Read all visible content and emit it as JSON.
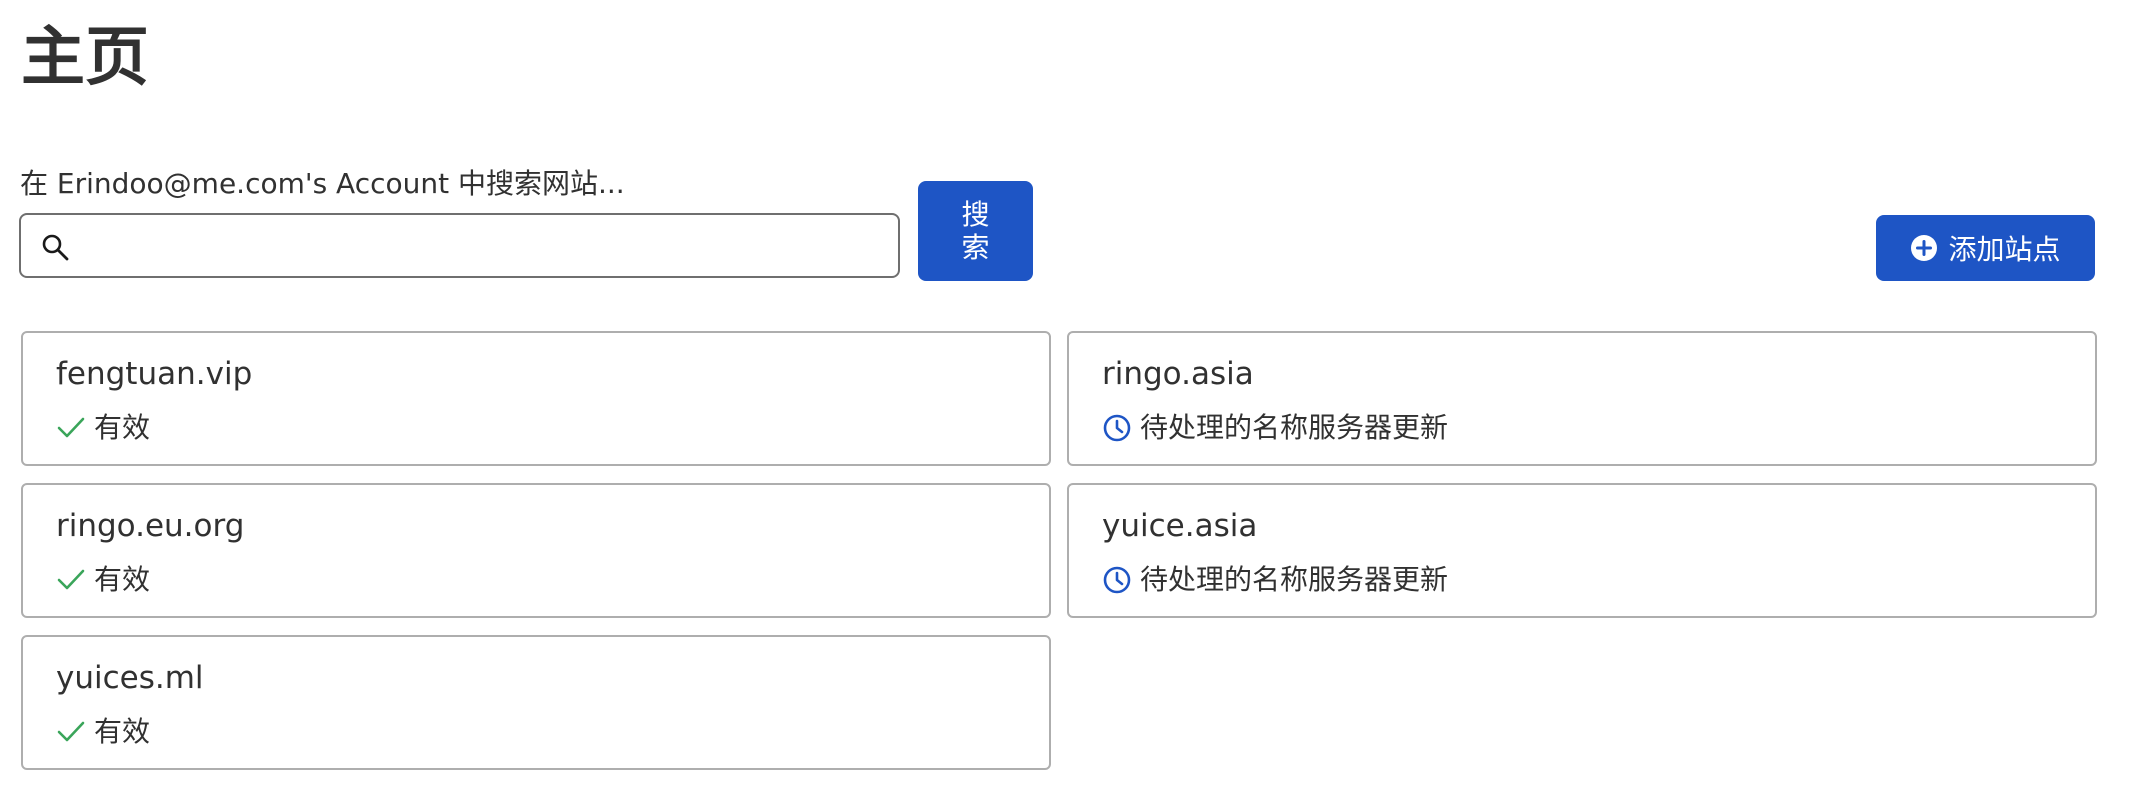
{
  "header": {
    "title": "主页"
  },
  "search": {
    "label": "在 Erindoo@me.com's Account 中搜索网站...",
    "value": "",
    "placeholder": "",
    "button_label": "搜索"
  },
  "actions": {
    "add_site_label": "添加站点"
  },
  "colors": {
    "primary": "#1e55c5",
    "success": "#3aa55a",
    "pending": "#1e55c5",
    "text": "#313131",
    "border": "#aeaeae"
  },
  "sites": [
    {
      "name": "fengtuan.vip",
      "status": "有效",
      "status_type": "active",
      "status_icon": "check-icon"
    },
    {
      "name": "ringo.asia",
      "status": "待处理的名称服务器更新",
      "status_type": "pending",
      "status_icon": "clock-icon"
    },
    {
      "name": "ringo.eu.org",
      "status": "有效",
      "status_type": "active",
      "status_icon": "check-icon"
    },
    {
      "name": "yuice.asia",
      "status": "待处理的名称服务器更新",
      "status_type": "pending",
      "status_icon": "clock-icon"
    },
    {
      "name": "yuices.ml",
      "status": "有效",
      "status_type": "active",
      "status_icon": "check-icon"
    }
  ]
}
